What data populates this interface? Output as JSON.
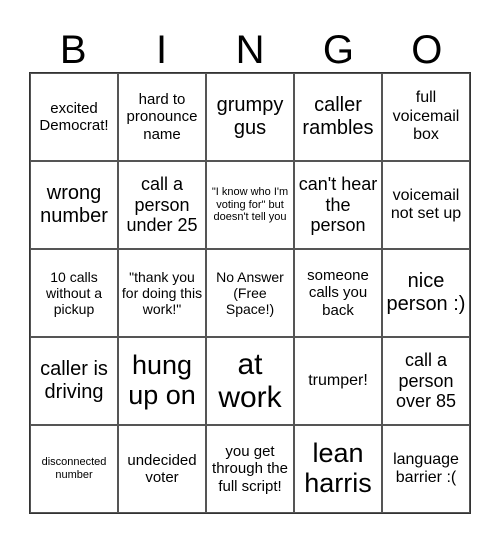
{
  "title_letters": [
    "B",
    "I",
    "N",
    "G",
    "O"
  ],
  "cells": [
    [
      "excited Democrat!",
      "hard to pronounce name",
      "grumpy gus",
      "caller rambles",
      "full voicemail box"
    ],
    [
      "wrong number",
      "call a person under 25",
      "\"I know who I'm voting for\" but doesn't tell you",
      "can't hear the person",
      "voicemail not set up"
    ],
    [
      "10 calls without a pickup",
      "\"thank you for doing this work!\"",
      "No Answer (Free Space!)",
      "someone calls you back",
      "nice person :)"
    ],
    [
      "caller is driving",
      "hung up on",
      "at work",
      "trumper!",
      "call a person over 85"
    ],
    [
      "disconnected number",
      "undecided voter",
      "you get through the full script!",
      "lean harris",
      "language barrier :("
    ]
  ]
}
